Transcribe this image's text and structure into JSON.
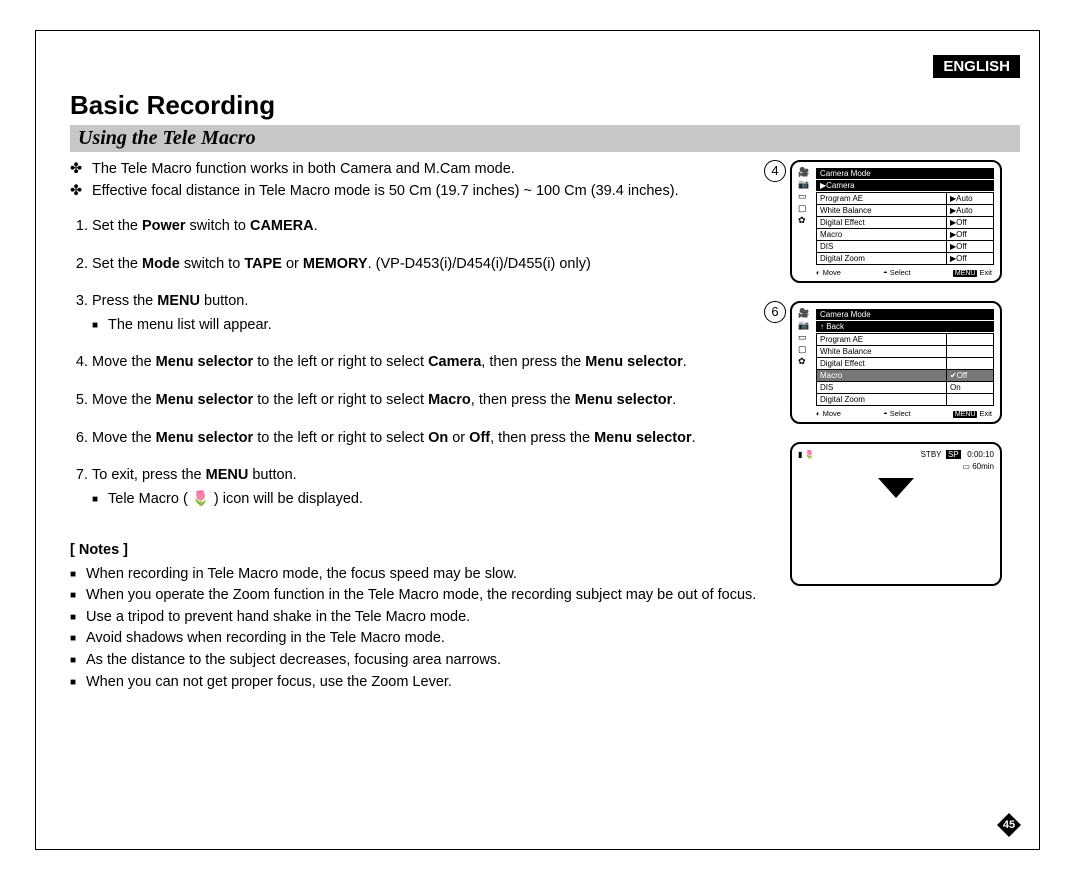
{
  "lang": "ENGLISH",
  "h1": "Basic Recording",
  "subtitle": "Using the Tele Macro",
  "intro": [
    "The Tele Macro function works in both Camera and M.Cam mode.",
    "Effective focal distance in Tele Macro mode is 50 Cm (19.7 inches) ~ 100 Cm (39.4 inches)."
  ],
  "steps": [
    {
      "pre": "Set the ",
      "b1": "Power",
      "mid": " switch to ",
      "b2": "CAMERA",
      "post": "."
    },
    {
      "pre": "Set the ",
      "b1": "Mode",
      "mid": " switch to ",
      "b2": "TAPE",
      "mid2": " or ",
      "b3": "MEMORY",
      "post": ". (VP-D453(i)/D454(i)/D455(i) only)"
    },
    {
      "pre": "Press the ",
      "b1": "MENU",
      "post": " button.",
      "sub": [
        "The menu list will appear."
      ]
    },
    {
      "pre": "Move the ",
      "b1": "Menu selector",
      "mid": " to the left or right to select ",
      "b2": "Camera",
      "mid2": ", then press the ",
      "b3": "Menu selector",
      "post": "."
    },
    {
      "pre": "Move the ",
      "b1": "Menu selector",
      "mid": " to the left or right to select ",
      "b2": "Macro",
      "mid2": ", then press the ",
      "b3": "Menu selector",
      "post": "."
    },
    {
      "pre": "Move the ",
      "b1": "Menu selector",
      "mid": " to the left or right to select ",
      "b2": "On",
      "mid2": " or ",
      "b3": "Off",
      "mid3": ", then press the ",
      "b4": "Menu selector",
      "post": "."
    },
    {
      "pre": "To exit, press the ",
      "b1": "MENU",
      "post": " button.",
      "sub": [
        "Tele Macro ( 🌷 ) icon will be displayed."
      ]
    }
  ],
  "notes_h": "[ Notes ]",
  "notes": [
    "When recording in Tele Macro mode, the focus speed may be slow.",
    "When you operate the Zoom function in the Tele Macro mode, the recording subject may be out of focus.",
    "Use a tripod to prevent hand shake in the Tele Macro mode.",
    "Avoid shadows when recording in the Tele Macro mode.",
    "As the distance to the subject decreases, focusing area narrows.",
    "When you can not get proper focus, use the Zoom Lever."
  ],
  "screens": {
    "s4": {
      "num": "4",
      "title": "Camera Mode",
      "crumb": "▶Camera",
      "rows": [
        {
          "label": "Program AE",
          "val": "▶Auto"
        },
        {
          "label": "White Balance",
          "val": "▶Auto"
        },
        {
          "label": "Digital Effect",
          "val": "▶Off"
        },
        {
          "label": "Macro",
          "val": "▶Off"
        },
        {
          "label": "DIS",
          "val": "▶Off"
        },
        {
          "label": "Digital Zoom",
          "val": "▶Off"
        }
      ],
      "footer": {
        "move": "Move",
        "select": "Select",
        "exit": "Exit",
        "menu": "MENU"
      }
    },
    "s6": {
      "num": "6",
      "title": "Camera Mode",
      "crumb": "↑ Back",
      "rows": [
        {
          "label": "Program AE",
          "val": ""
        },
        {
          "label": "White Balance",
          "val": ""
        },
        {
          "label": "Digital Effect",
          "val": ""
        },
        {
          "label": "Macro",
          "val": "✔Off",
          "hi": true
        },
        {
          "label": "DIS",
          "val": "On"
        },
        {
          "label": "Digital Zoom",
          "val": ""
        }
      ],
      "footer": {
        "move": "Move",
        "select": "Select",
        "exit": "Exit",
        "menu": "MENU"
      }
    },
    "status": {
      "stby": "STBY",
      "sp": "SP",
      "time": "0:00:10",
      "tape": "60min"
    }
  },
  "page_num": "45"
}
